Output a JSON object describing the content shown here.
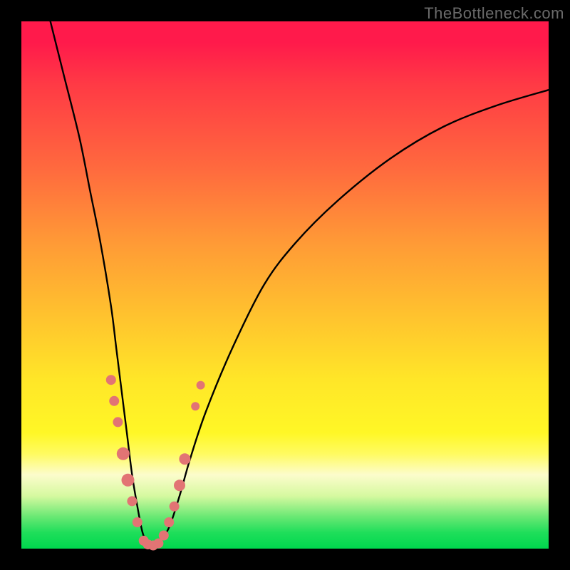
{
  "watermark": "TheBottleneck.com",
  "chart_data": {
    "type": "line",
    "title": "",
    "xlabel": "",
    "ylabel": "",
    "xlim": [
      0,
      100
    ],
    "ylim": [
      0,
      100
    ],
    "grid": false,
    "legend": false,
    "series": [
      {
        "name": "bottleneck-curve",
        "x": [
          5,
          8,
          11,
          13,
          15,
          17,
          18,
          19,
          20,
          21,
          22,
          23,
          24,
          25,
          26,
          28,
          30,
          32,
          35,
          40,
          46,
          52,
          60,
          70,
          80,
          90,
          100
        ],
        "y": [
          102,
          90,
          78,
          68,
          58,
          46,
          38,
          30,
          22,
          14,
          8,
          3,
          1,
          0.5,
          1,
          4,
          10,
          17,
          26,
          38,
          50,
          58,
          66,
          74,
          80,
          84,
          87
        ]
      }
    ],
    "markers": [
      {
        "name": "marker-left-1",
        "x": 17.0,
        "y": 32,
        "r": 7
      },
      {
        "name": "marker-left-2",
        "x": 17.6,
        "y": 28,
        "r": 7
      },
      {
        "name": "marker-left-3",
        "x": 18.3,
        "y": 24,
        "r": 7
      },
      {
        "name": "marker-left-4",
        "x": 19.3,
        "y": 18,
        "r": 9
      },
      {
        "name": "marker-left-5",
        "x": 20.2,
        "y": 13,
        "r": 9
      },
      {
        "name": "marker-left-6",
        "x": 21.0,
        "y": 9,
        "r": 7
      },
      {
        "name": "marker-left-7",
        "x": 22.0,
        "y": 5,
        "r": 7
      },
      {
        "name": "marker-bottom-1",
        "x": 23.2,
        "y": 1.5,
        "r": 7
      },
      {
        "name": "marker-bottom-2",
        "x": 24.0,
        "y": 0.8,
        "r": 7
      },
      {
        "name": "marker-bottom-3",
        "x": 25.0,
        "y": 0.6,
        "r": 7
      },
      {
        "name": "marker-bottom-4",
        "x": 26.0,
        "y": 1.0,
        "r": 7
      },
      {
        "name": "marker-bottom-5",
        "x": 27.0,
        "y": 2.5,
        "r": 7
      },
      {
        "name": "marker-right-1",
        "x": 28.0,
        "y": 5,
        "r": 7
      },
      {
        "name": "marker-right-2",
        "x": 29.0,
        "y": 8,
        "r": 7
      },
      {
        "name": "marker-right-3",
        "x": 30.0,
        "y": 12,
        "r": 8
      },
      {
        "name": "marker-right-4",
        "x": 31.0,
        "y": 17,
        "r": 8
      },
      {
        "name": "marker-right-5",
        "x": 33.0,
        "y": 27,
        "r": 6
      },
      {
        "name": "marker-right-6",
        "x": 34.0,
        "y": 31,
        "r": 6
      }
    ],
    "marker_color": "#e27474",
    "curve_color": "#000000"
  }
}
